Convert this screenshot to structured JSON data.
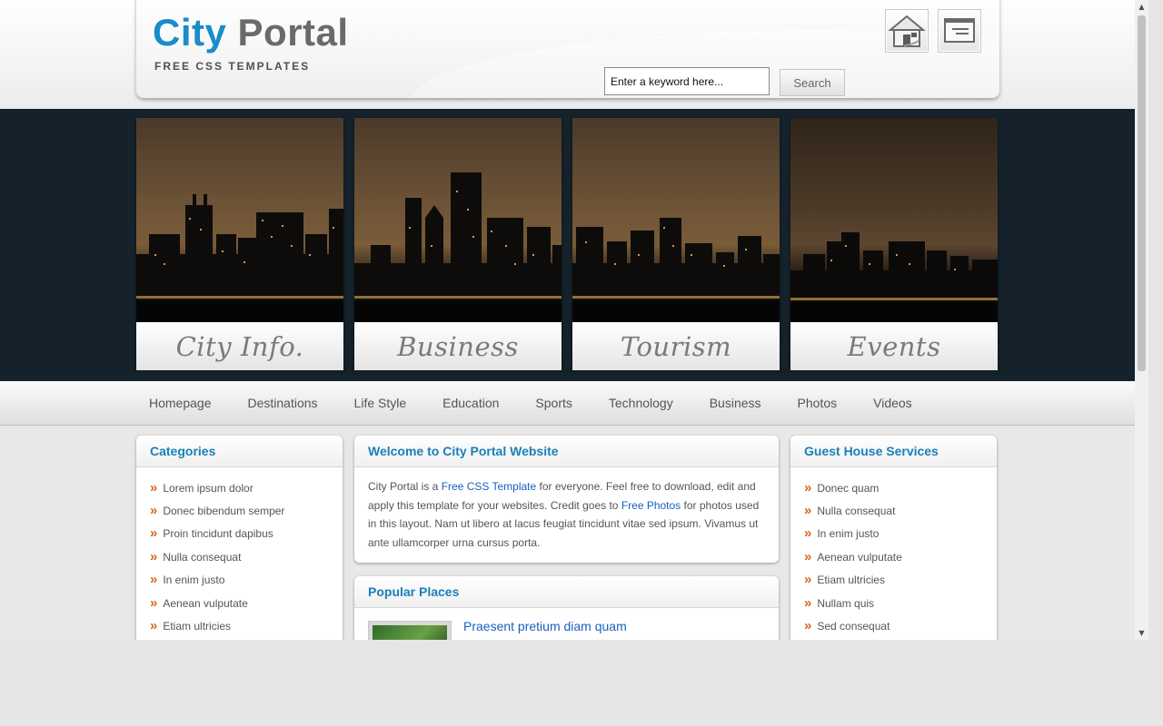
{
  "header": {
    "logo_city": "City",
    "logo_portal": "Portal",
    "tagline": "FREE CSS TEMPLATES",
    "icons": [
      "home-icon",
      "contact-card-icon"
    ],
    "search": {
      "placeholder": "Enter a keyword here...",
      "value": "Enter a keyword here...",
      "button_label": "Search"
    }
  },
  "banner": {
    "tiles": [
      {
        "caption": "City Info."
      },
      {
        "caption": "Business"
      },
      {
        "caption": "Tourism"
      },
      {
        "caption": "Events"
      }
    ]
  },
  "nav": {
    "items": [
      "Homepage",
      "Destinations",
      "Life Style",
      "Education",
      "Sports",
      "Technology",
      "Business",
      "Photos",
      "Videos"
    ]
  },
  "left": {
    "title": "Categories",
    "items": [
      "Lorem ipsum dolor",
      "Donec bibendum semper",
      "Proin tincidunt dapibus",
      "Nulla consequat",
      "In enim justo",
      "Aenean vulputate",
      "Etiam ultricies"
    ]
  },
  "center": {
    "welcome_title": "Welcome to City Portal Website",
    "welcome_text": {
      "p1": "City Portal is a ",
      "link1": "Free CSS Template",
      "p2": " for everyone. Feel free to download, edit and apply this template for your websites. Credit goes to ",
      "link2": "Free Photos",
      "p3": " for photos used in this layout. Nam ut libero at lacus feugiat tincidunt vitae sed ipsum. Vivamus ut ante ullamcorper urna cursus porta."
    },
    "popular_title": "Popular Places",
    "popular_first_item": "Praesent pretium diam quam"
  },
  "right": {
    "title": "Guest House Services",
    "items": [
      "Donec quam",
      "Nulla consequat",
      "In enim justo",
      "Aenean vulputate",
      "Etiam ultricies",
      "Nullam quis",
      "Sed consequat"
    ]
  },
  "colors": {
    "accent": "#1a8cc8",
    "link": "#1a5fbf",
    "bullet": "#d8651e",
    "banner_bg": "#15222b"
  }
}
